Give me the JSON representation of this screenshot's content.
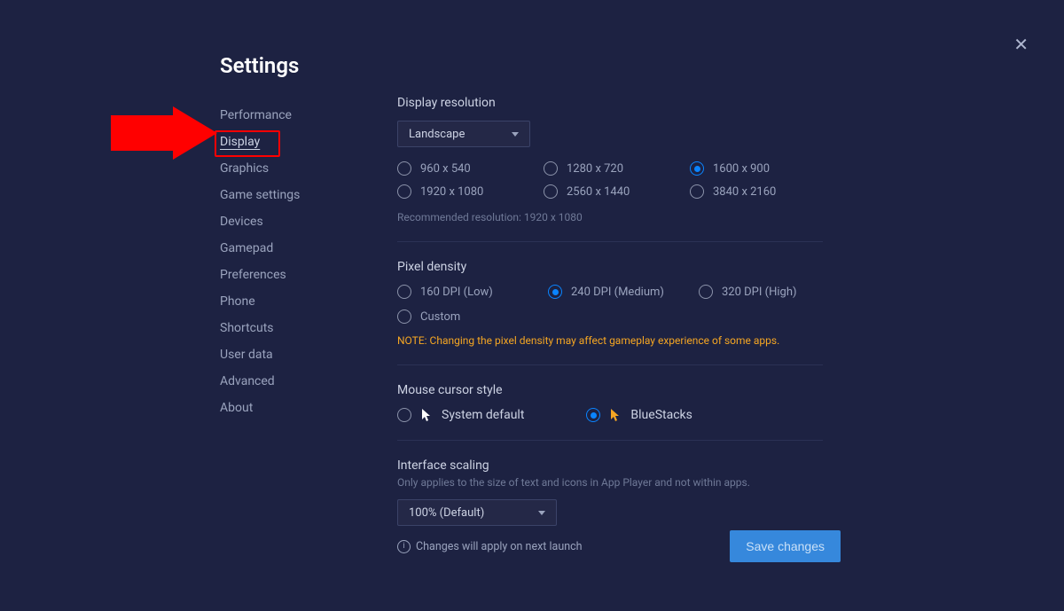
{
  "title": "Settings",
  "sidebar": {
    "items": [
      {
        "label": "Performance",
        "active": false
      },
      {
        "label": "Display",
        "active": true
      },
      {
        "label": "Graphics",
        "active": false
      },
      {
        "label": "Game settings",
        "active": false
      },
      {
        "label": "Devices",
        "active": false
      },
      {
        "label": "Gamepad",
        "active": false
      },
      {
        "label": "Preferences",
        "active": false
      },
      {
        "label": "Phone",
        "active": false
      },
      {
        "label": "Shortcuts",
        "active": false
      },
      {
        "label": "User data",
        "active": false
      },
      {
        "label": "Advanced",
        "active": false
      },
      {
        "label": "About",
        "active": false
      }
    ]
  },
  "display_resolution": {
    "heading": "Display resolution",
    "orientation_selected": "Landscape",
    "options": [
      {
        "label": "960 x 540",
        "checked": false
      },
      {
        "label": "1280 x 720",
        "checked": false
      },
      {
        "label": "1600 x 900",
        "checked": true
      },
      {
        "label": "1920 x 1080",
        "checked": false
      },
      {
        "label": "2560 x 1440",
        "checked": false
      },
      {
        "label": "3840 x 2160",
        "checked": false
      }
    ],
    "recommended": "Recommended resolution: 1920 x 1080"
  },
  "pixel_density": {
    "heading": "Pixel density",
    "options": [
      {
        "label": "160 DPI (Low)",
        "checked": false
      },
      {
        "label": "240 DPI (Medium)",
        "checked": true
      },
      {
        "label": "320 DPI (High)",
        "checked": false
      },
      {
        "label": "Custom",
        "checked": false
      }
    ],
    "note": "NOTE: Changing the pixel density may affect gameplay experience of some apps."
  },
  "mouse_cursor": {
    "heading": "Mouse cursor style",
    "options": [
      {
        "label": "System default",
        "checked": false,
        "icon": "system"
      },
      {
        "label": "BlueStacks",
        "checked": true,
        "icon": "bluestacks"
      }
    ]
  },
  "interface_scaling": {
    "heading": "Interface scaling",
    "description": "Only applies to the size of text and icons in App Player and not within apps.",
    "selected": "100% (Default)"
  },
  "footer": {
    "launch_note": "Changes will apply on next launch",
    "save_label": "Save changes"
  }
}
